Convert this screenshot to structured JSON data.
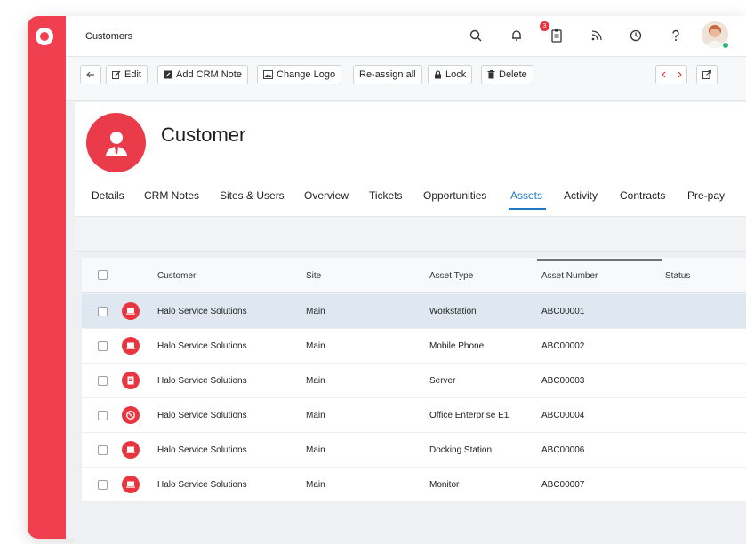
{
  "app": {
    "brand_color": "#f0404f",
    "accent_color": "#1e79c8"
  },
  "header": {
    "title": "Customers",
    "notification_count": "3",
    "icons": [
      "search-icon",
      "bell-icon",
      "clipboard-icon",
      "rss-icon",
      "clock-icon",
      "help-icon",
      "avatar"
    ]
  },
  "toolbar": {
    "back_icon": "arrow-left-icon",
    "edit_label": "Edit",
    "add_crm_note_label": "Add CRM Note",
    "change_logo_label": "Change Logo",
    "reassign_label": "Re-assign all",
    "lock_label": "Lock",
    "delete_label": "Delete"
  },
  "profile": {
    "name": "Customer",
    "avatar_icon": "customer-person-icon"
  },
  "tabs": [
    {
      "label": "Details"
    },
    {
      "label": "CRM Notes"
    },
    {
      "label": "Sites & Users"
    },
    {
      "label": "Overview"
    },
    {
      "label": "Tickets"
    },
    {
      "label": "Opportunities"
    },
    {
      "label": "Assets",
      "active": true
    },
    {
      "label": "Activity"
    },
    {
      "label": "Contracts"
    },
    {
      "label": "Pre-pay"
    }
  ],
  "table": {
    "columns": [
      "Customer",
      "Site",
      "Asset Type",
      "Asset Number",
      "Status"
    ],
    "rows": [
      {
        "icon": "laptop-icon",
        "customer": "Halo Service Solutions",
        "site": "Main",
        "asset_type": "Workstation",
        "asset_number": "ABC00001",
        "status": "",
        "selected": true
      },
      {
        "icon": "laptop-icon",
        "customer": "Halo Service Solutions",
        "site": "Main",
        "asset_type": "Mobile Phone",
        "asset_number": "ABC00002",
        "status": ""
      },
      {
        "icon": "server-icon",
        "customer": "Halo Service Solutions",
        "site": "Main",
        "asset_type": "Server",
        "asset_number": "ABC00003",
        "status": ""
      },
      {
        "icon": "disc-icon",
        "customer": "Halo Service Solutions",
        "site": "Main",
        "asset_type": "Office Enterprise E1",
        "asset_number": "ABC00004",
        "status": ""
      },
      {
        "icon": "laptop-icon",
        "customer": "Halo Service Solutions",
        "site": "Main",
        "asset_type": "Docking Station",
        "asset_number": "ABC00006",
        "status": ""
      },
      {
        "icon": "laptop-icon",
        "customer": "Halo Service Solutions",
        "site": "Main",
        "asset_type": "Monitor",
        "asset_number": "ABC00007",
        "status": ""
      }
    ]
  }
}
